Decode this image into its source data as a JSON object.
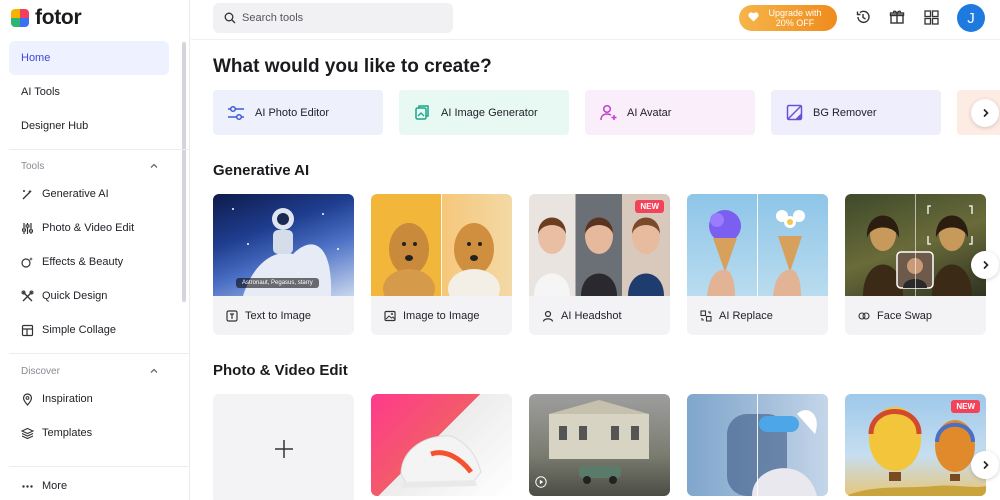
{
  "brand": {
    "name": "fotor"
  },
  "sidebar": {
    "nav": [
      {
        "label": "Home",
        "active": true
      },
      {
        "label": "AI Tools"
      },
      {
        "label": "Designer Hub"
      }
    ],
    "tools_header": "Tools",
    "tools": [
      {
        "label": "Generative AI",
        "icon": "magic-wand-icon"
      },
      {
        "label": "Photo & Video Edit",
        "icon": "sliders-icon"
      },
      {
        "label": "Effects & Beauty",
        "icon": "effects-icon"
      },
      {
        "label": "Quick Design",
        "icon": "quick-design-icon"
      },
      {
        "label": "Simple Collage",
        "icon": "collage-icon"
      }
    ],
    "discover_header": "Discover",
    "discover": [
      {
        "label": "Inspiration",
        "icon": "pin-icon"
      },
      {
        "label": "Templates",
        "icon": "layers-icon"
      }
    ],
    "more_label": "More"
  },
  "topbar": {
    "search_placeholder": "Search tools",
    "upgrade_line1": "Upgrade with",
    "upgrade_line2": "20% OFF",
    "avatar_letter": "J"
  },
  "main": {
    "heading": "What would you like to create?",
    "quick_actions": [
      {
        "label": "AI Photo Editor",
        "bg": "#eef0fb",
        "color": "#3b5bdb"
      },
      {
        "label": "AI Image Generator",
        "bg": "#e8f8f3",
        "color": "#19a58a"
      },
      {
        "label": "AI Avatar",
        "bg": "#fbeefb",
        "color": "#c03fd0"
      },
      {
        "label": "BG Remover",
        "bg": "#efeefc",
        "color": "#6a4fd8"
      }
    ],
    "generative_title": "Generative AI",
    "generative_cards": [
      {
        "label": "Text to Image",
        "chip": "Astronaut, Pegasus, starry"
      },
      {
        "label": "Image to Image"
      },
      {
        "label": "AI Headshot",
        "badge": "NEW"
      },
      {
        "label": "AI Replace"
      },
      {
        "label": "Face Swap"
      }
    ],
    "photo_title": "Photo & Video Edit",
    "photo_badge": "NEW"
  }
}
